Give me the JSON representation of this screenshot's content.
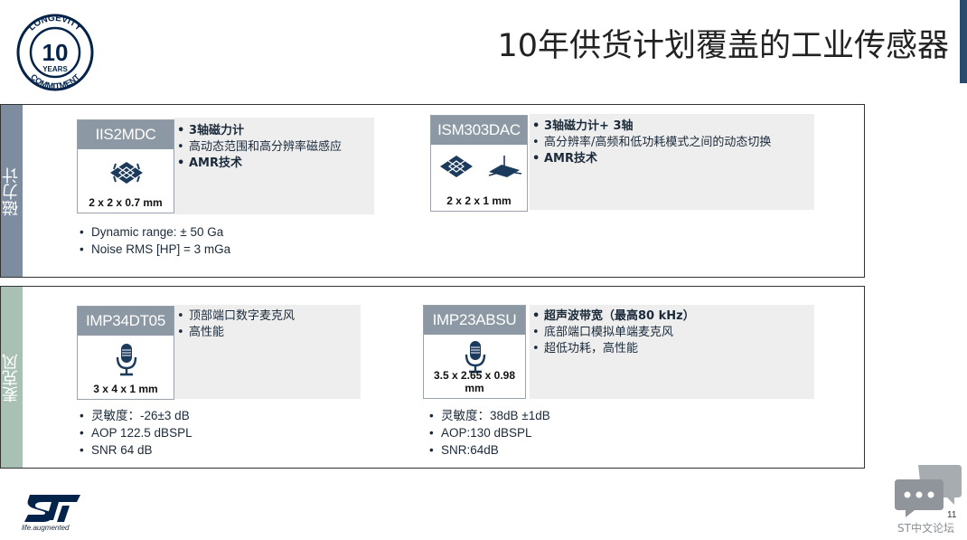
{
  "title": "10年供货计划覆盖的工业传感器",
  "badge": {
    "top_text": "LONGEVITY",
    "number": "10",
    "years": "YEARS",
    "bottom_text": "COMMITMENT"
  },
  "colors": {
    "magnetometer_side": "#7d8c9e",
    "microphone_side": "#a9c1b4",
    "part_header": "#8c98a3",
    "feature_bg": "#eeeeee",
    "accent_bar": "#2a4a6e",
    "st_blue": "#03234b"
  },
  "sections": {
    "magnetometer": {
      "label": "磁力计",
      "products": [
        {
          "part": "IIS2MDC",
          "dimensions": "2 x 2 x 0.7 mm",
          "icon": "magnetometer-chip-icon",
          "features": [
            "3轴磁力计",
            "高动态范围和高分辨率磁感应",
            "AMR技术"
          ],
          "specs": [
            "Dynamic range: ± 50 Ga",
            "Noise RMS [HP] = 3 mGa"
          ]
        },
        {
          "part": "ISM303DAC",
          "dimensions": "2 x 2 x 1 mm",
          "icon": "magnetometer-accelerometer-icon",
          "features": [
            "3轴磁力计+ 3轴",
            "高分辨率/高频和低功耗模式之间的动态切换",
            "AMR技术"
          ],
          "specs": []
        }
      ]
    },
    "microphone": {
      "label": "麦克风",
      "products": [
        {
          "part": "IMP34DT05",
          "dimensions": "3 x 4 x 1 mm",
          "icon": "microphone-icon",
          "features": [
            "顶部端口数字麦克风",
            "高性能"
          ],
          "specs": [
            "灵敏度：-26±3 dB",
            "AOP 122.5 dBSPL",
            "SNR 64 dB"
          ]
        },
        {
          "part": "IMP23ABSU",
          "dimensions": "3.5 x 2.65 x 0.98 mm",
          "icon": "microphone-icon",
          "features": [
            "超声波带宽（最高80 kHz）",
            "底部端口模拟单端麦克风",
            "超低功耗，高性能"
          ],
          "specs": [
            "灵敏度：38dB ±1dB",
            "AOP:130 dBSPL",
            "SNR:64dB"
          ]
        }
      ]
    }
  },
  "footer": {
    "tagline": "life.augmented",
    "page_number": "11",
    "forum": "ST中文论坛"
  }
}
